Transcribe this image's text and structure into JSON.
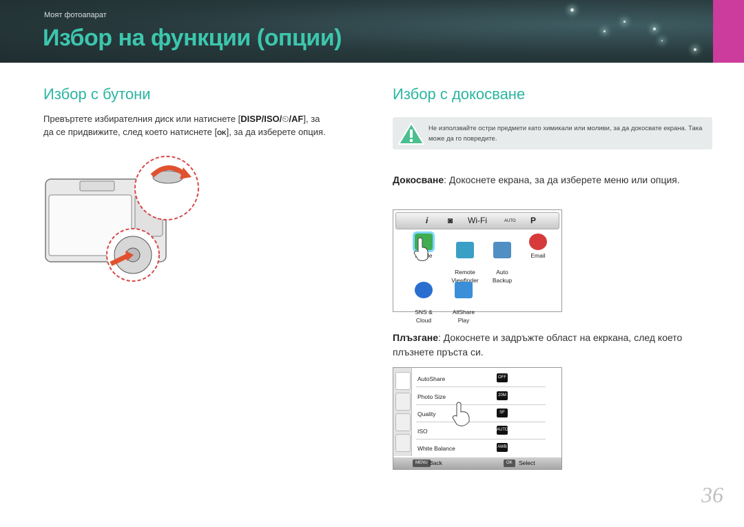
{
  "header": {
    "section": "Моят фотоапарат",
    "title": "Избор на функции (опции)",
    "accent": "#3cc6ad",
    "tab_color": "#cc3c9c"
  },
  "left": {
    "heading": "Избор с бутони",
    "line1_a": "Превъртете избирателния диск или натиснете [",
    "line1_keys": "DISP/ISO/",
    "line1_keys2": "/AF",
    "line1_b": "], за",
    "line2_a": "да се придвижите, след което натиснете [",
    "line2_key": "OK",
    "line2_b": "], за да изберете опция."
  },
  "right": {
    "heading": "Избор с докосване",
    "warning": "Не използвайте остри предмети като химикали или моливи, за да докосвате екрана. Така може да го повредите.",
    "touch_term": "Докосване",
    "touch_text": ": Докоснете екрана, за да изберете меню или опция.",
    "drag_term": "Плъзгане",
    "drag_text": ": Докоснете и задръжте област на екркана, след което плъзнете пръста си."
  },
  "screen1": {
    "tabs": [
      "i",
      "◙",
      "Wi-Fi",
      "AUTO",
      "P"
    ],
    "apps": [
      {
        "label": "Mobile",
        "icon": "mobile-link-icon",
        "color": "#3fae52"
      },
      {
        "label": "Remote\nViewfinder",
        "icon": "remote-viewfinder-icon",
        "color": "#3a9fc4"
      },
      {
        "label": "Auto\nBackup",
        "icon": "auto-backup-icon",
        "color": "#4f8fc4"
      },
      {
        "label": "Email",
        "icon": "email-icon",
        "color": "#d63a3a"
      },
      {
        "label": "SNS &\nCloud",
        "icon": "sns-cloud-icon",
        "color": "#2a6fd0"
      },
      {
        "label": "AllShare\nPlay",
        "icon": "allshare-play-icon",
        "color": "#3a8fd8"
      }
    ]
  },
  "screen2": {
    "rows": [
      {
        "label": "AutoShare",
        "value": "OFF"
      },
      {
        "label": "Photo Size",
        "value": "20M"
      },
      {
        "label": "Quality",
        "value": "SF"
      },
      {
        "label": "ISO",
        "value": "AUTO"
      },
      {
        "label": "White Balance",
        "value": "AWB"
      }
    ],
    "back_key": "MENU",
    "back_label": "Back",
    "select_key": "OK",
    "select_label": "Select"
  },
  "page_number": "36"
}
